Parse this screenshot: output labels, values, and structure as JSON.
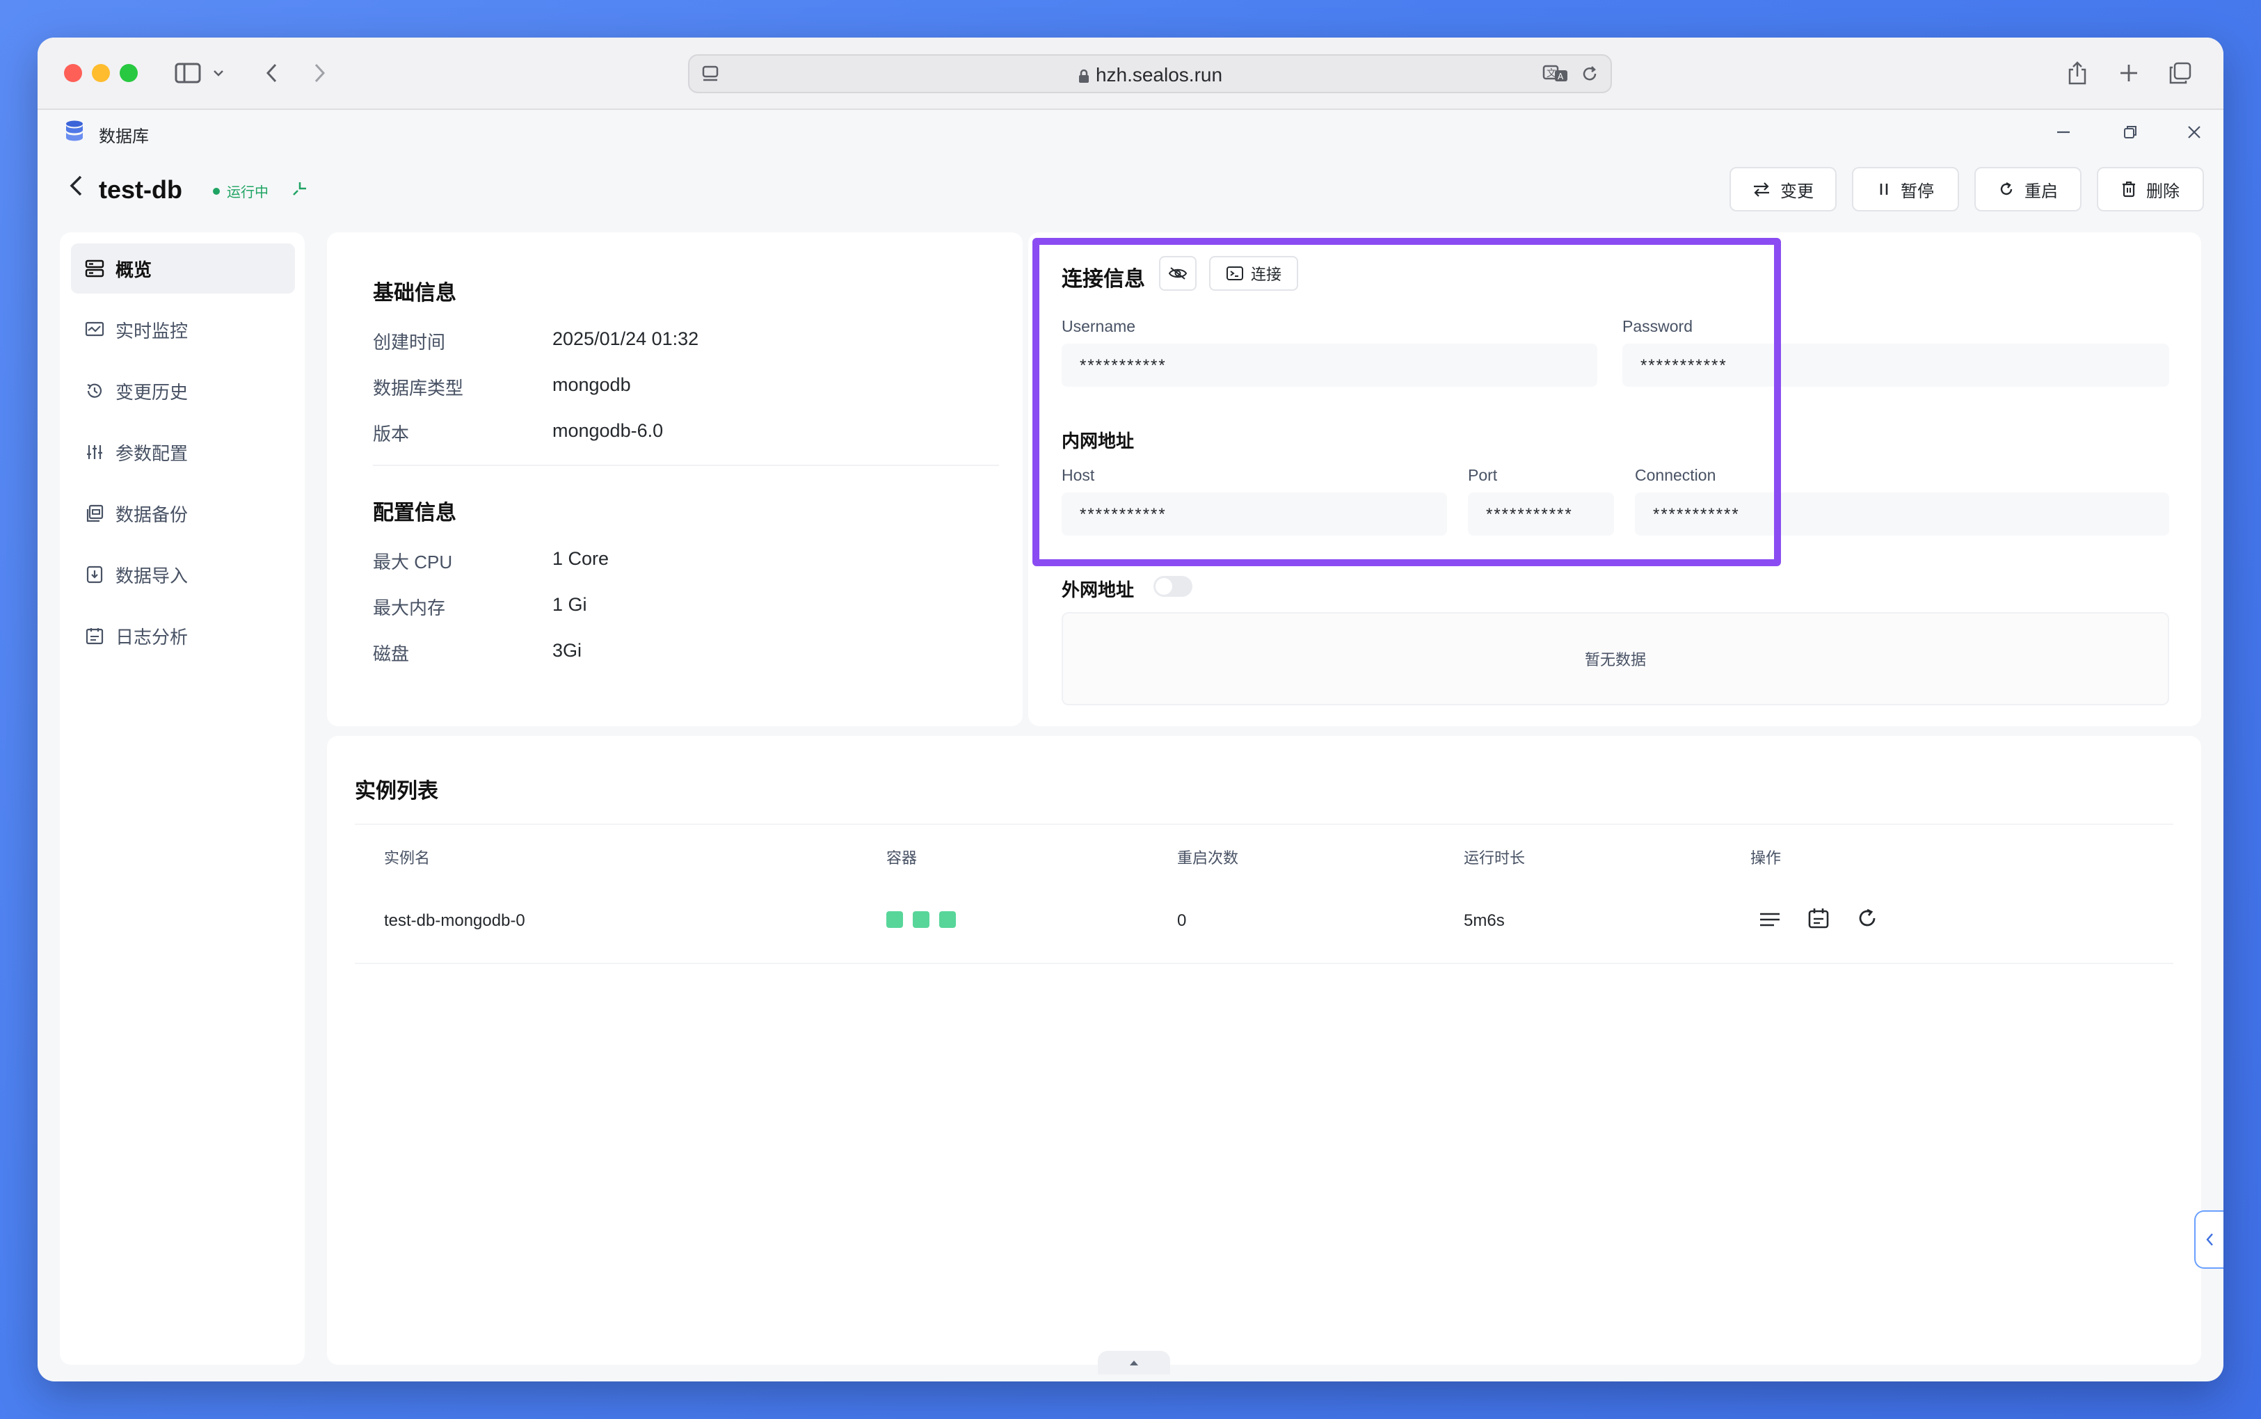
{
  "browser": {
    "url": "hzh.sealos.run"
  },
  "app": {
    "title": "数据库",
    "window_controls": [
      "minimize-icon",
      "restore-icon",
      "close-icon"
    ]
  },
  "header": {
    "db_name": "test-db",
    "status": "运行中",
    "buttons": {
      "change": "变更",
      "pause": "暂停",
      "restart": "重启",
      "delete": "删除"
    }
  },
  "sidebar": {
    "items": [
      {
        "label": "概览",
        "icon": "overview-icon"
      },
      {
        "label": "实时监控",
        "icon": "monitor-icon"
      },
      {
        "label": "变更历史",
        "icon": "history-icon"
      },
      {
        "label": "参数配置",
        "icon": "sliders-icon"
      },
      {
        "label": "数据备份",
        "icon": "backup-icon"
      },
      {
        "label": "数据导入",
        "icon": "import-icon"
      },
      {
        "label": "日志分析",
        "icon": "log-icon"
      }
    ]
  },
  "basic_info": {
    "title": "基础信息",
    "rows": [
      {
        "label": "创建时间",
        "value": "2025/01/24 01:32"
      },
      {
        "label": "数据库类型",
        "value": "mongodb"
      },
      {
        "label": "版本",
        "value": "mongodb-6.0"
      }
    ]
  },
  "config_info": {
    "title": "配置信息",
    "rows": [
      {
        "label": "最大 CPU",
        "value": "1 Core"
      },
      {
        "label": "最大内存",
        "value": "1 Gi"
      },
      {
        "label": "磁盘",
        "value": "3Gi"
      }
    ]
  },
  "connection": {
    "title": "连接信息",
    "connect_button": "连接",
    "username_label": "Username",
    "username_value": "***********",
    "password_label": "Password",
    "password_value": "***********",
    "internal_title": "内网地址",
    "host_label": "Host",
    "host_value": "***********",
    "port_label": "Port",
    "port_value": "***********",
    "connection_label": "Connection",
    "connection_value": "***********",
    "external_title": "外网地址",
    "external_enabled": false,
    "empty_text": "暂无数据",
    "highlight_color": "#8a4cf2"
  },
  "instances": {
    "title": "实例列表",
    "columns": [
      "实例名",
      "容器",
      "重启次数",
      "运行时长",
      "操作"
    ],
    "rows": [
      {
        "name": "test-db-mongodb-0",
        "containers": 3,
        "restarts": "0",
        "uptime": "5m6s"
      }
    ]
  }
}
